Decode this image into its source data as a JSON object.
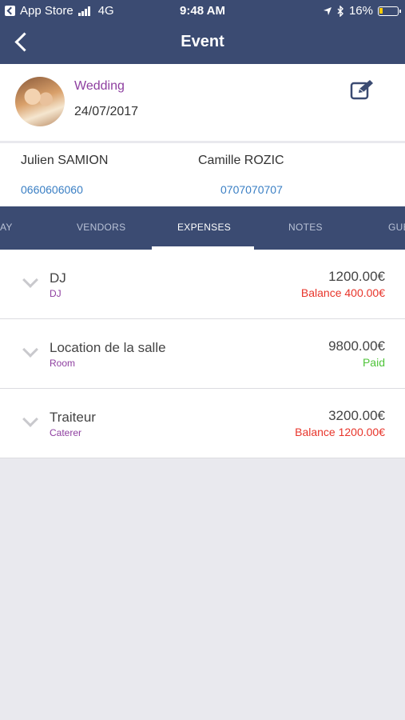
{
  "status_bar": {
    "carrier": "App Store",
    "network": "4G",
    "time": "9:48 AM",
    "battery": "16%"
  },
  "nav": {
    "title": "Event"
  },
  "event": {
    "type": "Wedding",
    "date": "24/07/2017"
  },
  "contacts": [
    {
      "name": "Julien SAMION",
      "phone": "0660606060"
    },
    {
      "name": "Camille ROZIC",
      "phone": "0707070707"
    }
  ],
  "tabs": [
    {
      "label": "AY"
    },
    {
      "label": "VENDORS"
    },
    {
      "label": "EXPENSES"
    },
    {
      "label": "NOTES"
    },
    {
      "label": "GUE"
    }
  ],
  "active_tab": "EXPENSES",
  "expenses": [
    {
      "title": "DJ",
      "category": "DJ",
      "amount": "1200.00€",
      "status": "Balance 400.00€",
      "status_color": "#e8352b"
    },
    {
      "title": "Location de la salle",
      "category": "Room",
      "amount": "9800.00€",
      "status": "Paid",
      "status_color": "#4fc43a"
    },
    {
      "title": "Traiteur",
      "category": "Caterer",
      "amount": "3200.00€",
      "status": "Balance 1200.00€",
      "status_color": "#e8352b"
    }
  ],
  "colors": {
    "header": "#3b4b72",
    "accent_purple": "#8e3fa0",
    "link_blue": "#3a7fc4"
  }
}
